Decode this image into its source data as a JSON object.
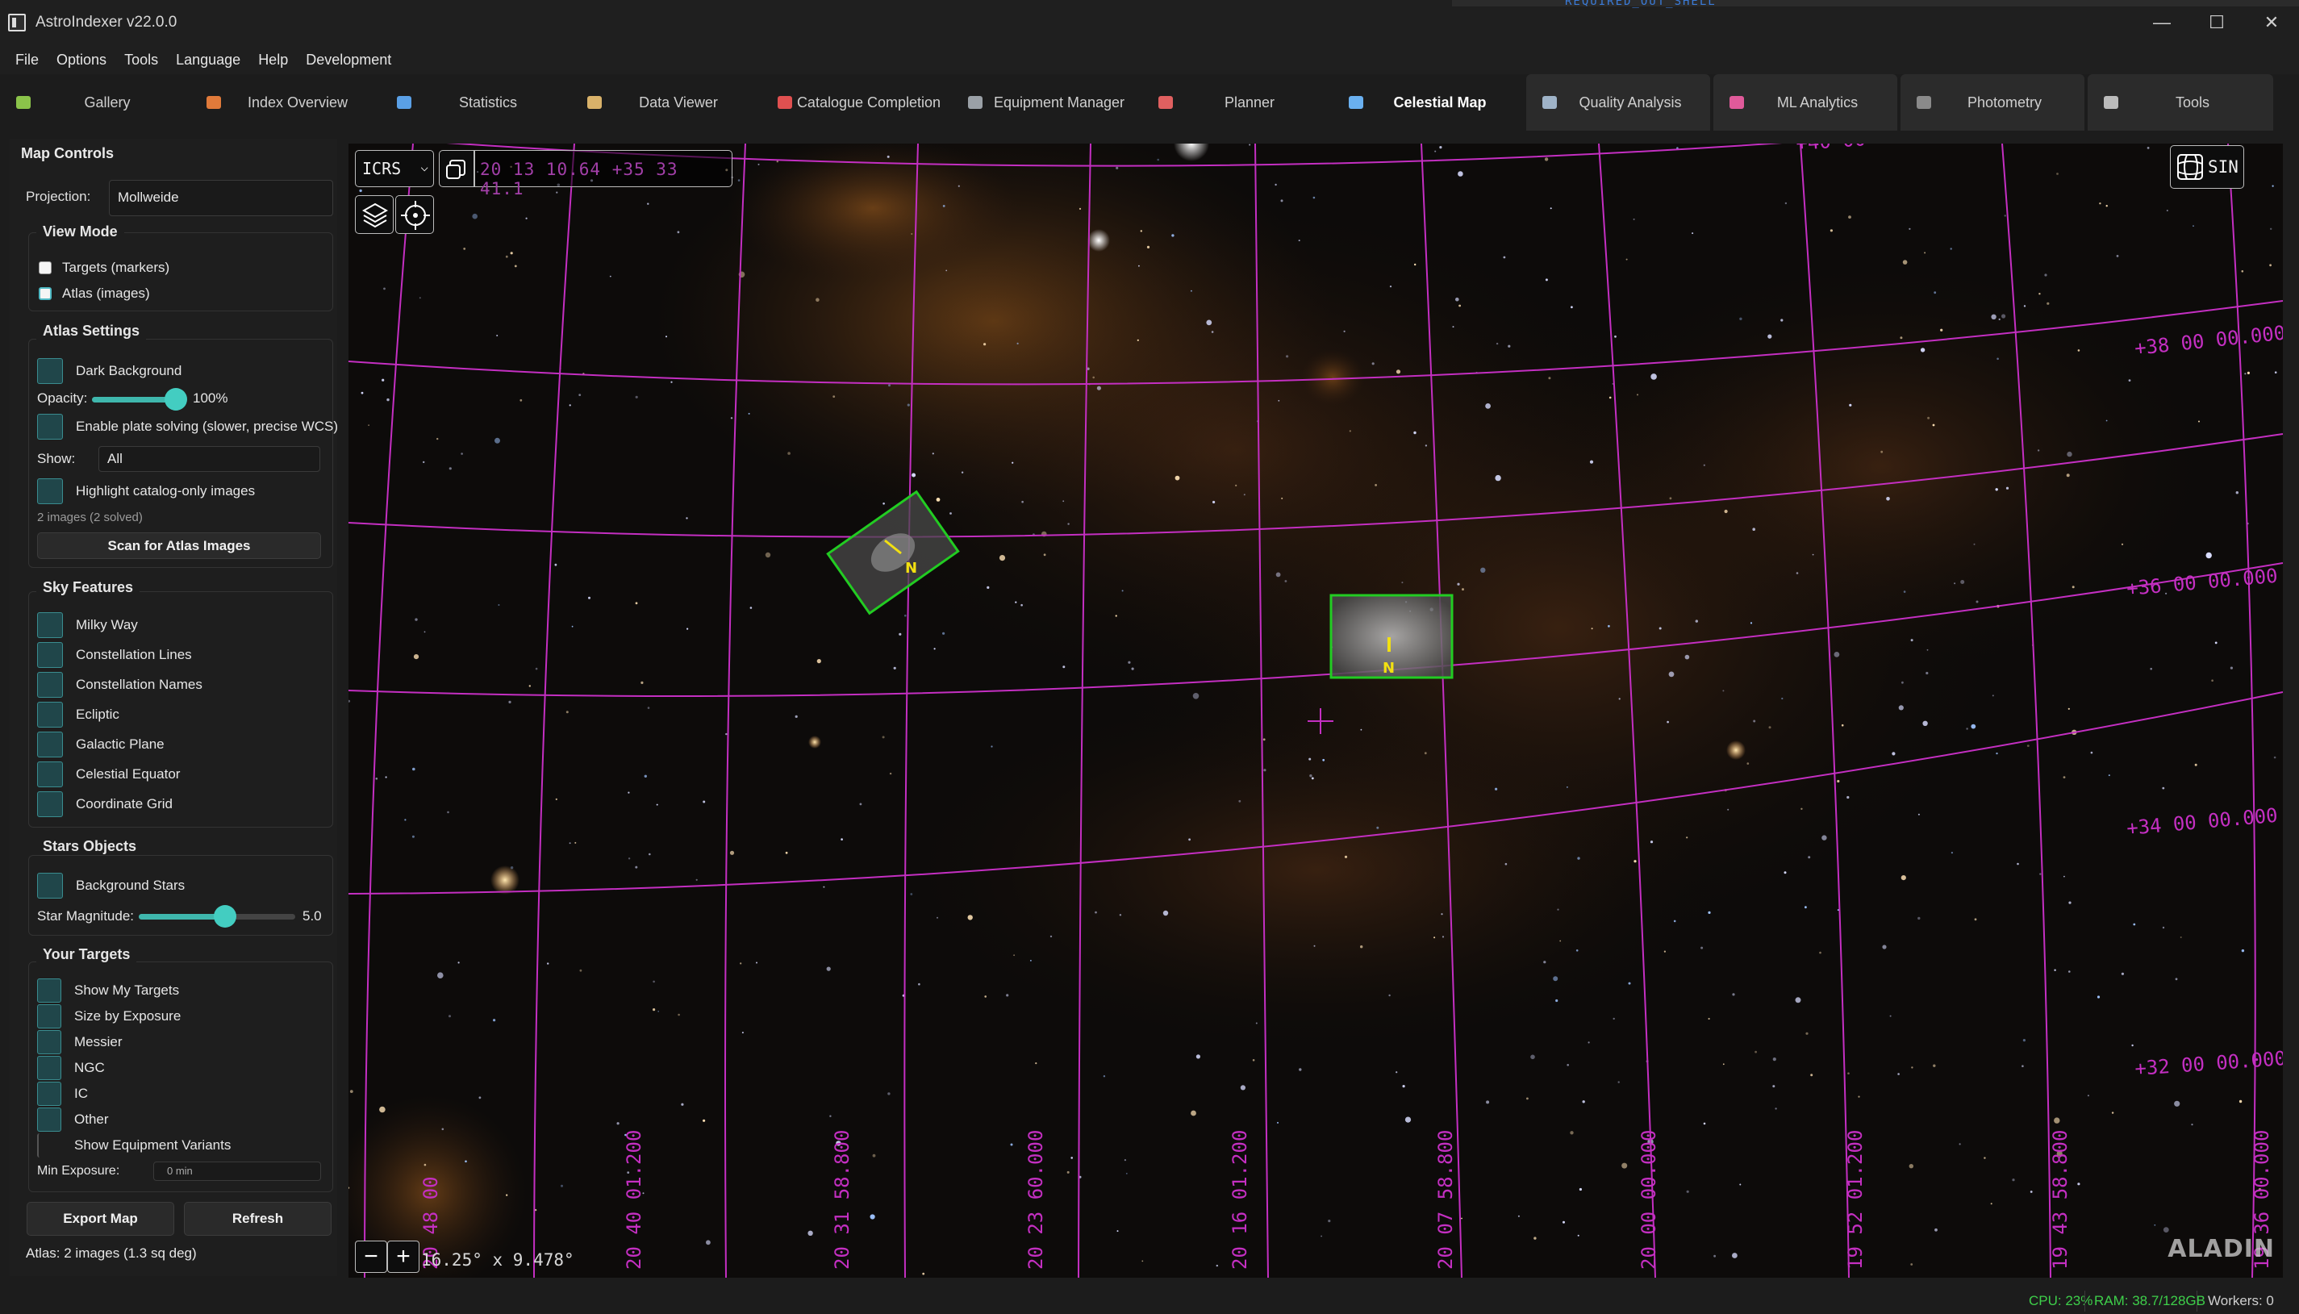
{
  "window": {
    "title": "AstroIndexer v22.0.0",
    "minimize": "—",
    "maximize": "☐",
    "close": "✕",
    "background_text": "REQUIRED_OUT_SHELL"
  },
  "menu": [
    "File",
    "Options",
    "Tools",
    "Language",
    "Help",
    "Development"
  ],
  "tabs": [
    {
      "label": "Gallery",
      "icon": "gallery-icon",
      "color": "#8bc34a"
    },
    {
      "label": "Index  Overview",
      "icon": "house-icon",
      "color": "#e07a3a"
    },
    {
      "label": "Statistics",
      "icon": "bar-chart-icon",
      "color": "#5aa0e6"
    },
    {
      "label": "Data Viewer",
      "icon": "clipboard-icon",
      "color": "#d9b26a"
    },
    {
      "label": "Catalogue Completion",
      "icon": "target-icon",
      "color": "#e05050"
    },
    {
      "label": "Equipment Manager",
      "icon": "wrench-icon",
      "color": "#9aa0a6"
    },
    {
      "label": "Planner",
      "icon": "calendar-icon",
      "color": "#e06060"
    },
    {
      "label": "Celestial Map",
      "icon": "chart-line-icon",
      "color": "#6ab0f0"
    },
    {
      "label": "Quality Analysis",
      "icon": "microscope-icon",
      "color": "#9fb3c8"
    },
    {
      "label": "ML Analytics",
      "icon": "trend-chart-icon",
      "color": "#e05a9a"
    },
    {
      "label": "Photometry",
      "icon": "camera-icon",
      "color": "#8a8a8a"
    },
    {
      "label": "Tools",
      "icon": "hammer-wrench-icon",
      "color": "#bbbbbb"
    }
  ],
  "active_tab": "Celestial Map",
  "controls": {
    "title": "Map Controls",
    "projection_label": "Projection:",
    "projection_value": "Mollweide",
    "view_mode": {
      "title": "View Mode",
      "options": [
        "Targets (markers)",
        "Atlas (images)"
      ]
    },
    "atlas": {
      "title": "Atlas Settings",
      "dark_background": "Dark Background",
      "opacity_label": "Opacity:",
      "opacity_value": "100%",
      "opacity_fraction": 1.0,
      "plate_solving": "Enable plate solving (slower, precise WCS)",
      "show_label": "Show:",
      "show_value": "All",
      "highlight": "Highlight catalog-only images",
      "count": "2 images (2 solved)",
      "scan_button": "Scan for Atlas Images"
    },
    "sky_features": {
      "title": "Sky Features",
      "items": [
        "Milky Way",
        "Constellation Lines",
        "Constellation Names",
        "Ecliptic",
        "Galactic Plane",
        "Celestial Equator",
        "Coordinate Grid"
      ]
    },
    "stars": {
      "title": "Stars  Objects",
      "background_stars": "Background Stars",
      "magnitude_label": "Star Magnitude:",
      "magnitude_value": "5.0",
      "magnitude_fraction": 0.55
    },
    "targets": {
      "title": "Your Targets",
      "items": [
        "Show My Targets",
        "Size by Exposure",
        "Messier",
        "NGC",
        "IC",
        "Other",
        "Show Equipment Variants"
      ],
      "min_exposure_label": "Min Exposure:",
      "min_exposure_value": "0 min"
    },
    "export_button": "Export Map",
    "refresh_button": "Refresh",
    "atlas_status": "Atlas: 2 images (1.3 sq deg)"
  },
  "map": {
    "frame": "ICRS",
    "coords": "20 13 10.64 +35 33 41.1",
    "projection": "SIN",
    "fov": "16.25° x 9.478°",
    "zoom_out": "−",
    "zoom_in": "+",
    "logo": "ALADIN",
    "dec_labels": [
      "+40 00",
      "+38 00 00.000",
      "+36 00 00.000",
      "+34 00 00.000",
      "+32 00 00.000"
    ],
    "ra_labels": [
      "20 48 00",
      "20 40 01.200",
      "20 31 58.800",
      "20 23 60.000",
      "20 16 01.200",
      "20 07 58.800",
      "20 00 00.000",
      "19 52 01.200",
      "19 43 58.800",
      "19 36 00.000"
    ],
    "footprint_label": "N",
    "grid_color": "#c42fc2",
    "footprint_color": "#22cc22"
  },
  "status": {
    "cpu": "CPU: 23%",
    "ram": "RAM: 38.7/128GB",
    "workers": "Workers: 0",
    "cpu_color": "#3ecf4a"
  }
}
